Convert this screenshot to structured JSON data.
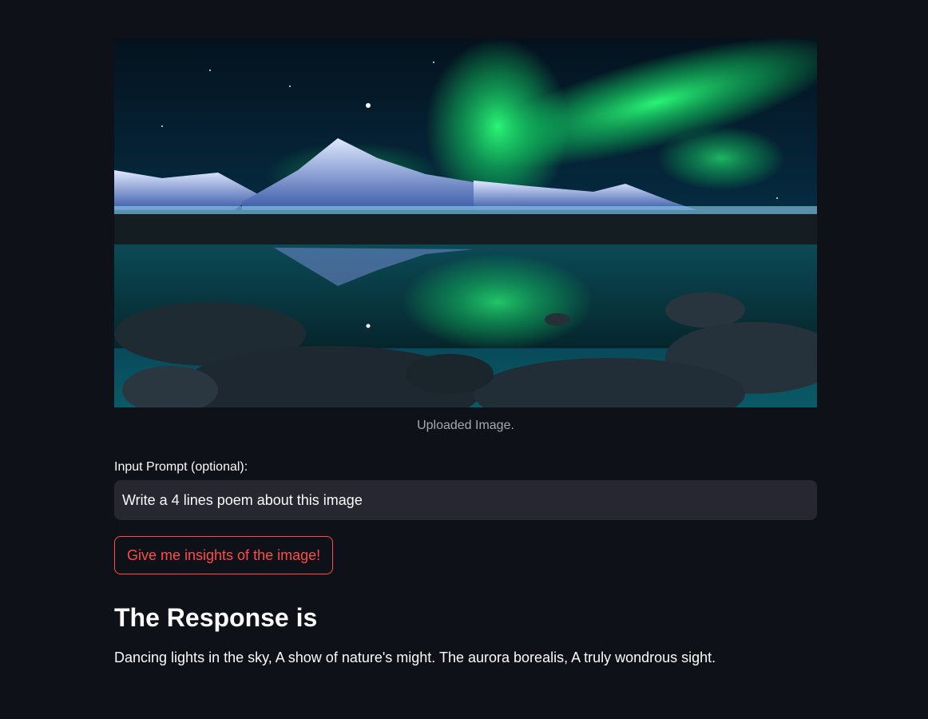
{
  "image": {
    "caption": "Uploaded Image.",
    "alt": "Aurora borealis over snowy mountains reflected in a lake"
  },
  "prompt": {
    "label": "Input Prompt (optional):",
    "value": "Write a 4 lines poem about this image"
  },
  "button": {
    "label": "Give me insights of the image!"
  },
  "response": {
    "heading": "The Response is",
    "text": "Dancing lights in the sky, A show of nature's might. The aurora borealis, A truly wondrous sight."
  },
  "colors": {
    "background": "#0e1117",
    "input_bg": "#262730",
    "accent": "#ff4b4b",
    "caption": "#a3a8b4"
  }
}
